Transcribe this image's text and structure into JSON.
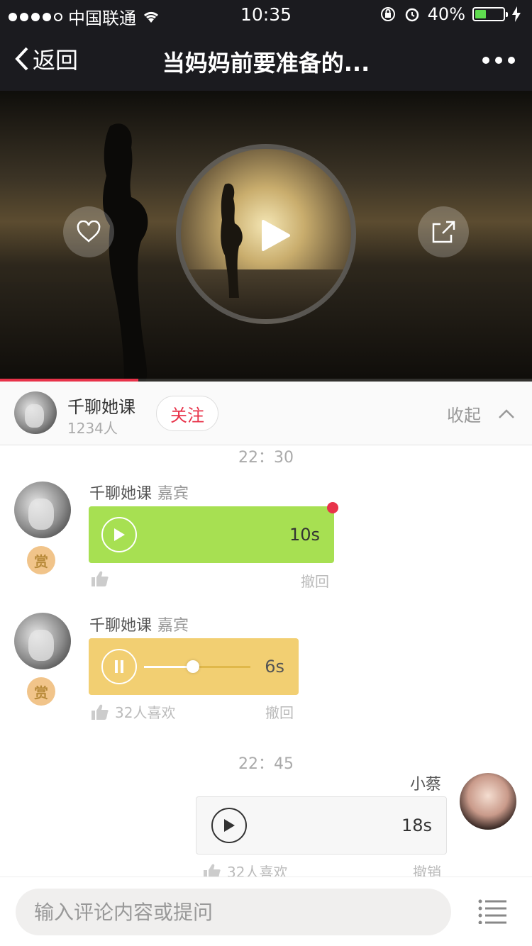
{
  "status_bar": {
    "carrier": "中国联通",
    "time": "10:35",
    "battery": "40%",
    "battery_level": 0.4
  },
  "nav": {
    "back_label": "返回",
    "title": "当妈妈前要准备的..."
  },
  "player": {
    "progress": 0.26
  },
  "author": {
    "name": "千聊她课",
    "count": "1234人",
    "follow_label": "关注",
    "collapse_label": "收起"
  },
  "messages": [
    {
      "timestamp": "22：30",
      "sender": "千聊她课",
      "role": "嘉宾",
      "reward": "赏",
      "duration": "10s",
      "likes": "",
      "recall": "撤回",
      "bubble_color": "#a7e052"
    },
    {
      "sender": "千聊她课",
      "role": "嘉宾",
      "reward": "赏",
      "duration": "6s",
      "likes": "32人喜欢",
      "recall": "撤回",
      "bubble_color": "#f2cf72",
      "playback": 0.46
    },
    {
      "timestamp": "22：45",
      "sender": "小蔡",
      "duration": "18s",
      "likes": "32人喜欢",
      "recall": "撤销"
    }
  ],
  "footer": {
    "placeholder": "输入评论内容或提问"
  }
}
